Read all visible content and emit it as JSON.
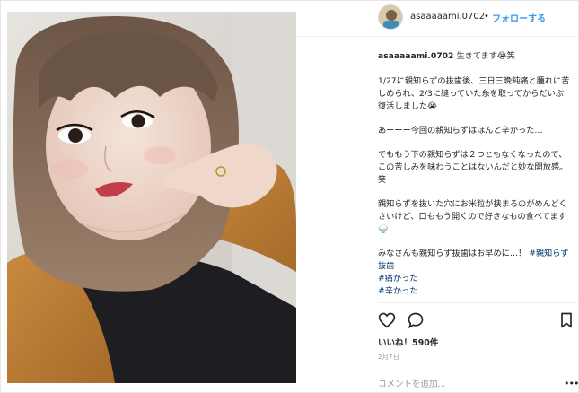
{
  "post": {
    "username": "asaaaaami.0702",
    "separator": "•",
    "follow_label": "フォローする",
    "caption": {
      "first_line_text": "生きてます😭笑",
      "paragraphs": [
        "1/27に親知らずの抜歯後、三日三晩鈍痛と腫れに苦しめられ、2/3に縫っていた糸を取ってからだいぶ復活しました😭",
        "あーーー今回の親知らずはほんと辛かった…",
        "でももう下の親知らずは２つともなくなったので、この苦しみを味わうことはないんだと妙な開放感。笑",
        "親知らずを抜いた穴にお米粒が挟まるのがめんどくさいけど、口ももう開くので好きなもの食べてます🍚"
      ],
      "closing_line": "みなさんも親知らず抜歯はお早めに…！",
      "hashtags": [
        "#親知らず抜歯",
        "#痛かった",
        "#辛かった"
      ]
    },
    "likes_label": "いいね！590件",
    "date_label": "2月7日",
    "comment_placeholder": "コメントを追加...",
    "more_label": "•••"
  },
  "icons": {
    "like": "heart-icon",
    "comment": "comment-icon",
    "save": "bookmark-icon"
  },
  "colors": {
    "link_blue": "#3897f0",
    "hashtag": "#003569",
    "text": "#262626",
    "muted": "#999999"
  }
}
